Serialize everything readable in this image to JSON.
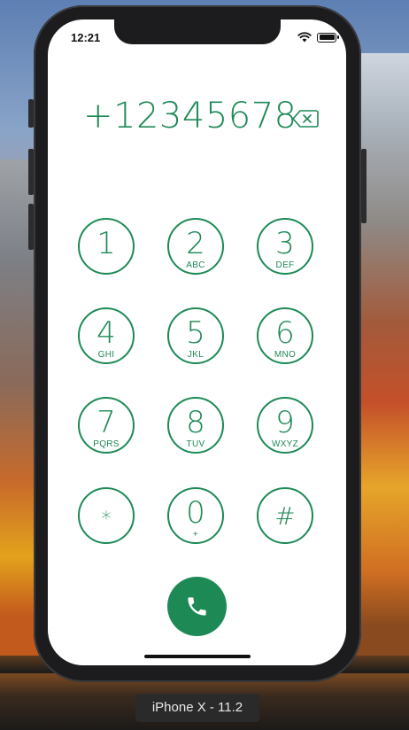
{
  "status_bar": {
    "time": "12:21"
  },
  "dialer": {
    "number": "+12345678",
    "keys": [
      {
        "digit": "1",
        "letters": ""
      },
      {
        "digit": "2",
        "letters": "ABC"
      },
      {
        "digit": "3",
        "letters": "DEF"
      },
      {
        "digit": "4",
        "letters": "GHI"
      },
      {
        "digit": "5",
        "letters": "JKL"
      },
      {
        "digit": "6",
        "letters": "MNO"
      },
      {
        "digit": "7",
        "letters": "PQRS"
      },
      {
        "digit": "8",
        "letters": "TUV"
      },
      {
        "digit": "9",
        "letters": "WXYZ"
      },
      {
        "digit": "*",
        "letters": ""
      },
      {
        "digit": "0",
        "letters": "+"
      },
      {
        "digit": "#",
        "letters": ""
      }
    ]
  },
  "simulator": {
    "label": "iPhone X - 11.2"
  },
  "colors": {
    "accent": "#1d8a56",
    "call_button": "#1d8a56"
  },
  "icons": {
    "backspace": "backspace-icon",
    "call": "phone-icon",
    "wifi": "wifi-icon",
    "battery": "battery-icon"
  }
}
